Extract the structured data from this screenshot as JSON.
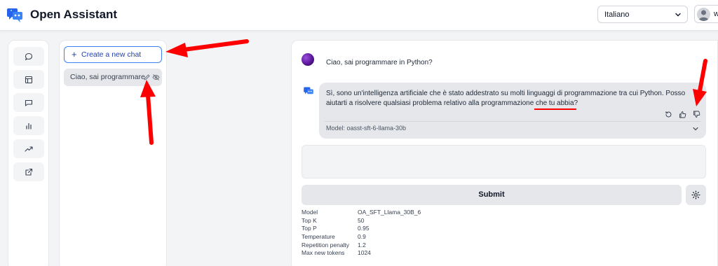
{
  "header": {
    "app_title": "Open Assistant",
    "language": "Italiano",
    "user_initial": "w"
  },
  "nav": {
    "items": [
      {
        "icon": "chat-bubble-icon"
      },
      {
        "icon": "layout-icon"
      },
      {
        "icon": "message-square-icon"
      },
      {
        "icon": "bar-chart-icon"
      },
      {
        "icon": "trending-up-icon"
      },
      {
        "icon": "external-link-icon"
      }
    ]
  },
  "sidebar": {
    "new_chat_label": "Create a new chat",
    "chats": [
      {
        "title": "Ciao, sai programmare"
      }
    ]
  },
  "conversation": {
    "user_message": "Ciao, sai programmare in Python?",
    "assistant_message": "Sì, sono un'intelligenza artificiale che è stato addestrato su molti linguaggi di programmazione tra cui Python. Posso aiutarti a risolvere qualsiasi problema relativo alla programmazione che tu abbia?",
    "model_label": "Model: oasst-sft-6-llama-30b"
  },
  "composer": {
    "placeholder": "",
    "submit_label": "Submit"
  },
  "parameters": [
    {
      "name": "Model",
      "value": "OA_SFT_Llama_30B_6"
    },
    {
      "name": "Top K",
      "value": "50"
    },
    {
      "name": "Top P",
      "value": "0.95"
    },
    {
      "name": "Temperature",
      "value": "0.9"
    },
    {
      "name": "Repetition penalty",
      "value": "1.2"
    },
    {
      "name": "Max new tokens",
      "value": "1024"
    }
  ],
  "colors": {
    "accent": "#3b82f6",
    "annotation": "#ff0000"
  }
}
